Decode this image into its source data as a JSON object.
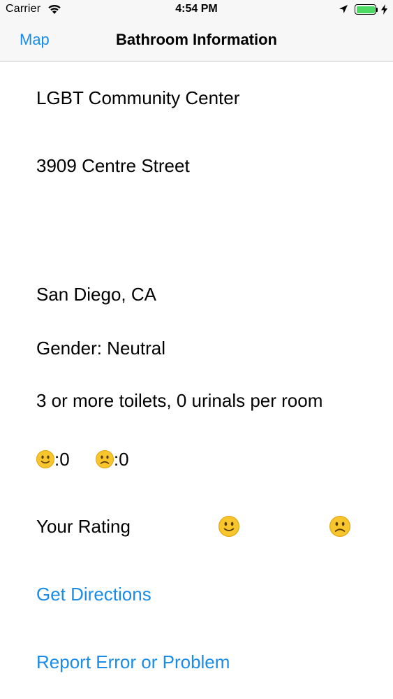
{
  "status_bar": {
    "carrier": "Carrier",
    "time": "4:54 PM",
    "battery_color": "#4cd964"
  },
  "nav": {
    "back_label": "Map",
    "title": "Bathroom Information",
    "tint_color": "#1a8ce8"
  },
  "bathroom": {
    "name": "LGBT Community Center",
    "street": "3909 Centre Street",
    "city": "San Diego, CA",
    "gender": "Gender: Neutral",
    "fixtures": "3 or more toilets, 0 urinals per room"
  },
  "ratings": {
    "upvote_count": ":0",
    "downvote_count": ":0",
    "your_rating_label": "Your Rating"
  },
  "actions": {
    "directions_label": "Get Directions",
    "report_label": "Report Error or Problem"
  },
  "icons": {
    "happy": "slightly-smiling-face-icon",
    "sad": "frowning-face-icon"
  }
}
